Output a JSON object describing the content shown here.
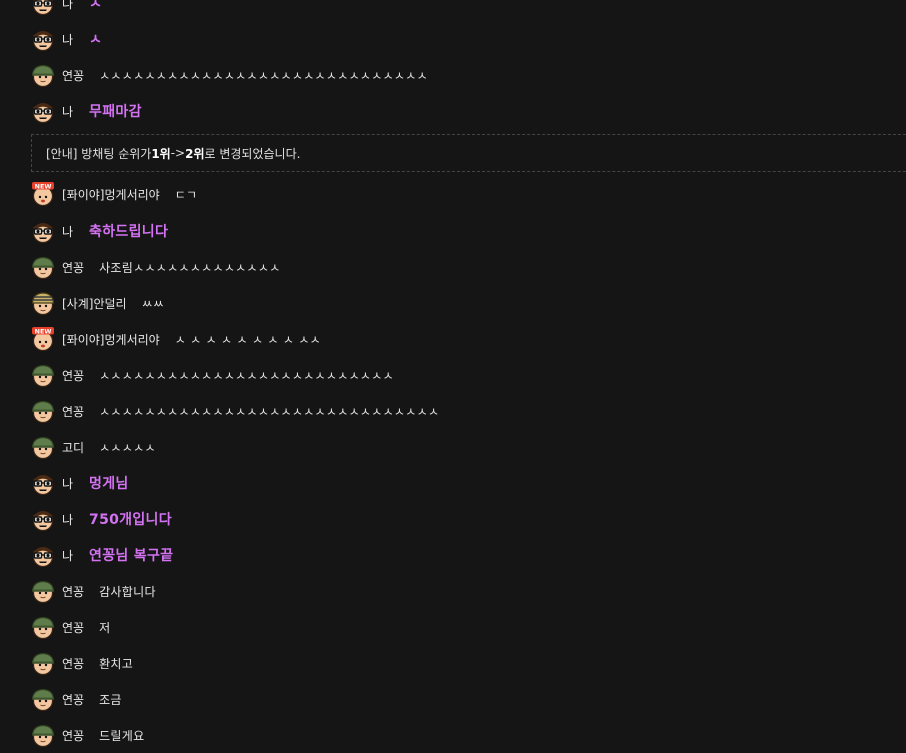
{
  "notice": {
    "prefix": "[안내] 방채팅 순위가 ",
    "from_rank": "1위",
    "arrow": " -> ",
    "to_rank": "2위",
    "suffix": " 로 변경되었습니다."
  },
  "avatar_badge": "NEW",
  "messages": [
    {
      "avatar": "sunglasses-avatar-icon",
      "name": "나",
      "text": "ㅅ",
      "me": true
    },
    {
      "avatar": "sunglasses-avatar-icon",
      "name": "나",
      "text": "ㅅ",
      "me": true
    },
    {
      "avatar": "soldier-helmet-avatar-icon",
      "name": "연꽁",
      "text": "ㅅㅅㅅㅅㅅㅅㅅㅅㅅㅅㅅㅅㅅㅅㅅㅅㅅㅅㅅㅅㅅㅅㅅㅅㅅㅅㅅㅅㅅ",
      "me": false
    },
    {
      "avatar": "sunglasses-avatar-icon",
      "name": "나",
      "text": "무패마감",
      "me": true
    },
    {
      "avatar": "new-badge-avatar-icon",
      "name": "[퐈이야]멍게서리야",
      "text": "ㄷㄱ",
      "me": false
    },
    {
      "avatar": "sunglasses-avatar-icon",
      "name": "나",
      "text": "축하드립니다",
      "me": true
    },
    {
      "avatar": "soldier-helmet-avatar-icon",
      "name": "연꽁",
      "text": "사조림ㅅㅅㅅㅅㅅㅅㅅㅅㅅㅅㅅㅅㅅ",
      "me": false
    },
    {
      "avatar": "striped-helmet-avatar-icon",
      "name": "[사계]안덜리",
      "text": "ㅆㅆ",
      "me": false
    },
    {
      "avatar": "new-badge-avatar-icon",
      "name": "[퐈이야]멍게서리야",
      "text": "ㅅ ㅅ ㅅ ㅅ ㅅ ㅅ ㅅ ㅅ ㅅㅅ",
      "me": false
    },
    {
      "avatar": "soldier-helmet-avatar-icon",
      "name": "연꽁",
      "text": "ㅅㅅㅅㅅㅅㅅㅅㅅㅅㅅㅅㅅㅅㅅㅅㅅㅅㅅㅅㅅㅅㅅㅅㅅㅅㅅ",
      "me": false
    },
    {
      "avatar": "soldier-helmet-avatar-icon",
      "name": "연꽁",
      "text": "ㅅㅅㅅㅅㅅㅅㅅㅅㅅㅅㅅㅅㅅㅅㅅㅅㅅㅅㅅㅅㅅㅅㅅㅅㅅㅅㅅㅅㅅㅅ",
      "me": false
    },
    {
      "avatar": "soldier-helmet-avatar-icon",
      "name": "고디",
      "text": "ㅅㅅㅅㅅㅅ",
      "me": false
    },
    {
      "avatar": "sunglasses-avatar-icon",
      "name": "나",
      "text": "멍게님",
      "me": true
    },
    {
      "avatar": "sunglasses-avatar-icon",
      "name": "나",
      "text": "750개입니다",
      "me": true
    },
    {
      "avatar": "sunglasses-avatar-icon",
      "name": "나",
      "text": "연꽁님 복구끝",
      "me": true
    },
    {
      "avatar": "soldier-helmet-avatar-icon",
      "name": "연꽁",
      "text": "감사합니다",
      "me": false
    },
    {
      "avatar": "soldier-helmet-avatar-icon",
      "name": "연꽁",
      "text": "저",
      "me": false
    },
    {
      "avatar": "soldier-helmet-avatar-icon",
      "name": "연꽁",
      "text": "환치고",
      "me": false
    },
    {
      "avatar": "soldier-helmet-avatar-icon",
      "name": "연꽁",
      "text": "조금",
      "me": false
    },
    {
      "avatar": "soldier-helmet-avatar-icon",
      "name": "연꽁",
      "text": "드릴게요",
      "me": false
    }
  ],
  "colors": {
    "background": "#151515",
    "my_message": "#d372f2",
    "text": "#e8e8e8",
    "notice_border": "#444444"
  }
}
